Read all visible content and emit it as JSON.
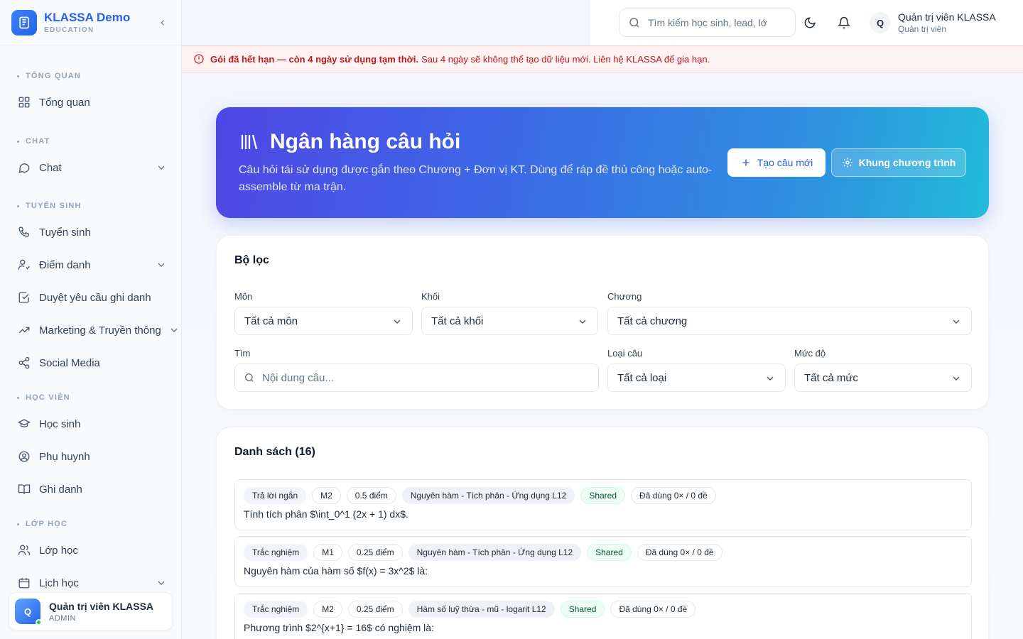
{
  "brand": {
    "name": "KLASSA Demo",
    "sub": "EDUCATION"
  },
  "sidebar": {
    "sections": [
      {
        "title": "TỔNG QUAN",
        "items": [
          {
            "label": "Tổng quan"
          }
        ]
      },
      {
        "title": "CHAT",
        "items": [
          {
            "label": "Chat"
          }
        ]
      },
      {
        "title": "TUYỂN SINH",
        "items": [
          {
            "label": "Tuyển sinh"
          },
          {
            "label": "Điểm danh"
          },
          {
            "label": "Duyệt yêu cầu ghi danh"
          },
          {
            "label": "Marketing & Truyền thông"
          },
          {
            "label": "Social Media"
          }
        ]
      },
      {
        "title": "HỌC VIÊN",
        "items": [
          {
            "label": "Học sinh"
          },
          {
            "label": "Phụ huynh"
          },
          {
            "label": "Ghi danh"
          }
        ]
      },
      {
        "title": "LỚP HỌC",
        "items": [
          {
            "label": "Lớp học"
          },
          {
            "label": "Lịch học"
          }
        ]
      }
    ],
    "user": {
      "initial": "Q",
      "name": "Quản trị viên KLASSA",
      "role": "ADMIN"
    }
  },
  "header": {
    "search_placeholder": "Tìm kiếm học sinh, lead, lớ",
    "user_initial": "Q",
    "user_name": "Quản trị viên KLASSA",
    "user_role": "Quản trị viên"
  },
  "alert": {
    "strong": "Gói đã hết hạn — còn 4 ngày sử dụng tạm thời.",
    "text": "Sau 4 ngày sẽ không thể tạo dữ liệu mới. Liên hệ KLASSA để gia hạn."
  },
  "hero": {
    "title": "Ngân hàng câu hỏi",
    "desc": "Câu hỏi tái sử dụng được gắn theo Chương + Đơn vị KT. Dùng để ráp đề thủ công hoặc auto-assemble từ ma trận.",
    "new_label": "Tạo câu mới",
    "frame_label": "Khung chương trình"
  },
  "filters": {
    "title": "Bộ lọc",
    "subject": {
      "label": "Môn",
      "value": "Tất cả môn"
    },
    "grade": {
      "label": "Khối",
      "value": "Tất cả khối"
    },
    "chapter": {
      "label": "Chương",
      "value": "Tất cả chương"
    },
    "search": {
      "label": "Tìm",
      "placeholder": "Nội dung câu..."
    },
    "type": {
      "label": "Loại câu",
      "value": "Tất cả loại"
    },
    "level": {
      "label": "Mức độ",
      "value": "Tất cả mức"
    }
  },
  "list": {
    "title": "Danh sách (16)",
    "items": [
      {
        "type": "Trả lời ngắn",
        "level": "M2",
        "points": "0.5 điểm",
        "chapter": "Nguyên hàm - Tích phân - Ứng dụng L12",
        "shared": "Shared",
        "used": "Đã dùng 0× / 0 đề",
        "text": "Tính tích phân $\\int_0^1 (2x + 1) dx$."
      },
      {
        "type": "Trắc nghiệm",
        "level": "M1",
        "points": "0.25 điểm",
        "chapter": "Nguyên hàm - Tích phân - Ứng dụng L12",
        "shared": "Shared",
        "used": "Đã dùng 0× / 0 đề",
        "text": "Nguyên hàm của hàm số $f(x) = 3x^2$ là:"
      },
      {
        "type": "Trắc nghiệm",
        "level": "M2",
        "points": "0.25 điểm",
        "chapter": "Hàm số luỹ thừa - mũ - logarit L12",
        "shared": "Shared",
        "used": "Đã dùng 0× / 0 đề",
        "text": "Phương trình $2^{x+1} = 16$ có nghiệm là:"
      }
    ]
  },
  "colors": {
    "brand": "#2563eb",
    "alert": "#b91c1c",
    "hero_start": "#4f46e5",
    "hero_end": "#22bcd9"
  }
}
